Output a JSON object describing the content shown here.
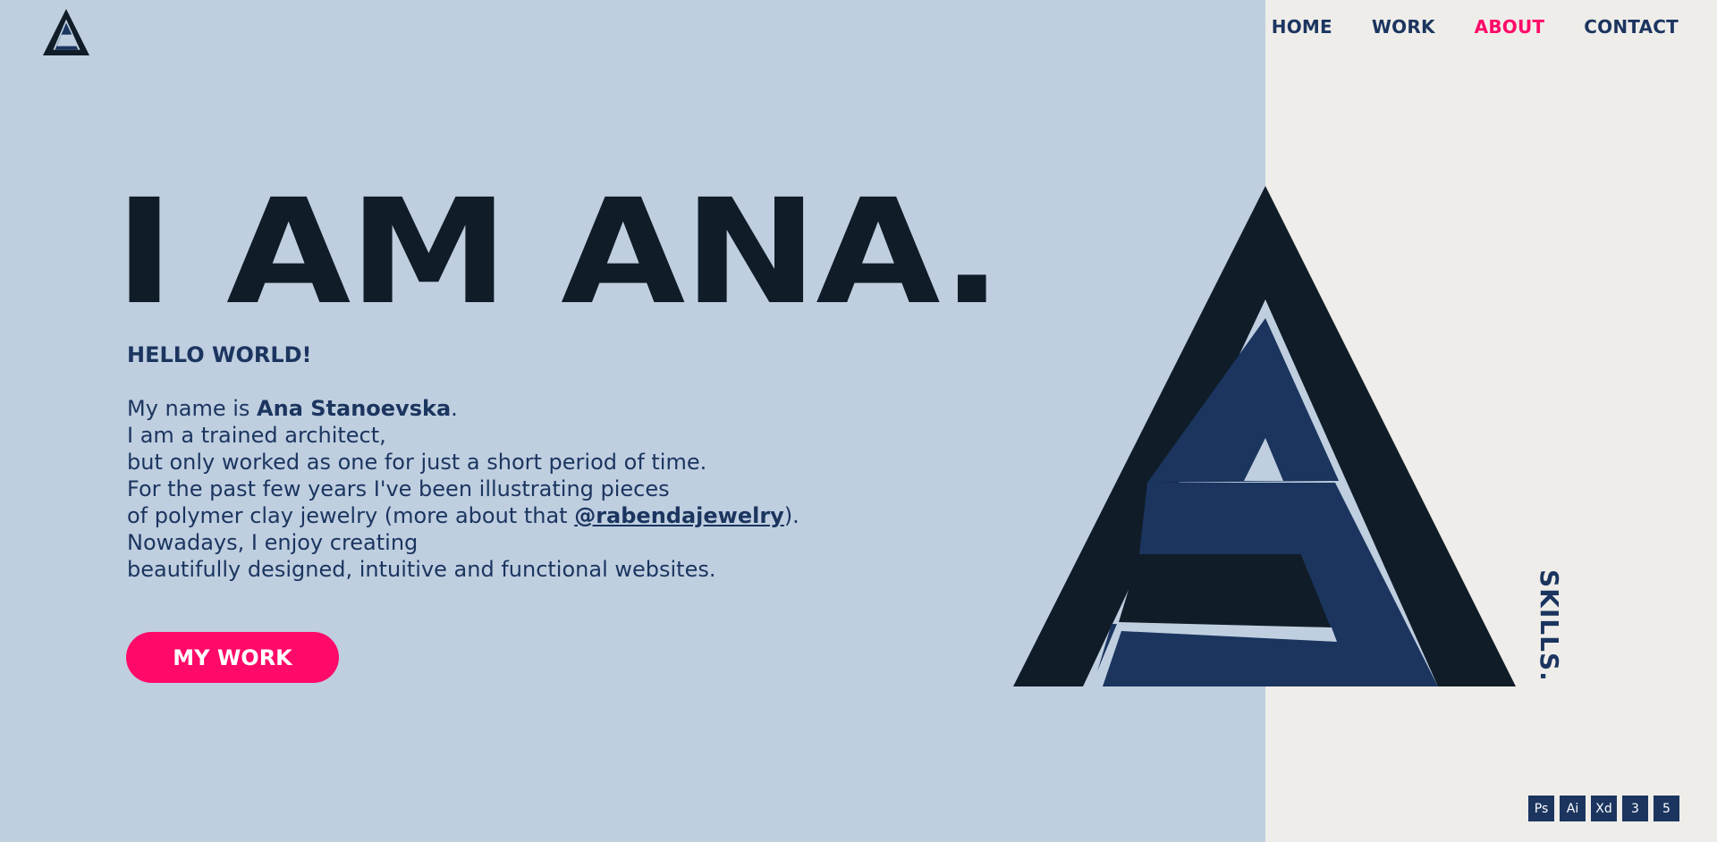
{
  "logo": {
    "icon": "as-monogram-logo",
    "color_dark": "#101c28",
    "color_blue": "#1b355f"
  },
  "nav": {
    "items": [
      {
        "label": "HOME"
      },
      {
        "label": "WORK"
      },
      {
        "label": "ABOUT",
        "active": true
      },
      {
        "label": "CONTACT"
      }
    ]
  },
  "hero": {
    "headline": "I AM ANA.",
    "greeting": "HELLO WORLD!",
    "bio": {
      "line1_prefix": "My name is ",
      "name": "Ana Stanoevska",
      "line1_suffix": ".",
      "line2": "I am a trained architect,",
      "line3": "but only worked as one for just a short period of time.",
      "line4": "For the past few years I've been illustrating pieces",
      "line5_prefix": "of polymer clay jewelry (more about that ",
      "handle": "@rabendajewelry",
      "line5_suffix": ").",
      "line6": "Nowadays, I enjoy creating",
      "line7": "beautifully designed, intuitive and functional websites."
    },
    "cta_label": "MY WORK"
  },
  "skills": {
    "label": "SKILLS.",
    "icons": [
      {
        "name": "photoshop-icon",
        "text": "Ps"
      },
      {
        "name": "illustrator-icon",
        "text": "Ai"
      },
      {
        "name": "xd-icon",
        "text": "Xd"
      },
      {
        "name": "css3-icon",
        "text": "3"
      },
      {
        "name": "html5-icon",
        "text": "5"
      }
    ]
  },
  "colors": {
    "left_bg": "#bfcfe0",
    "right_bg": "#efedea",
    "navy": "#1b355f",
    "dark": "#101c28",
    "accent": "#ff0a68"
  }
}
